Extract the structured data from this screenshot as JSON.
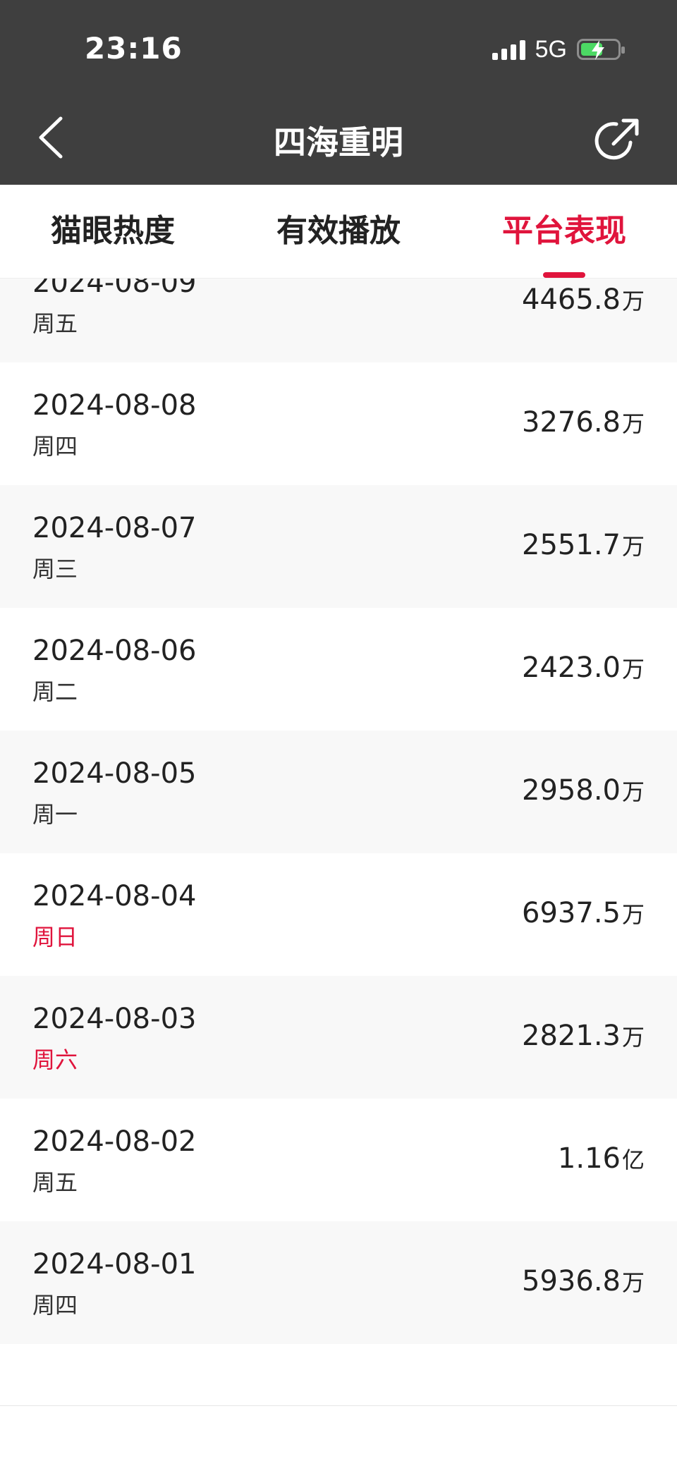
{
  "status_bar": {
    "time": "23:16",
    "network": "5G"
  },
  "nav": {
    "title": "四海重明",
    "back_icon": "chevron-left-icon",
    "share_icon": "share-refresh-icon"
  },
  "tabs": [
    {
      "label": "猫眼热度",
      "active": false
    },
    {
      "label": "有效播放",
      "active": false
    },
    {
      "label": "平台表现",
      "active": true
    }
  ],
  "colors": {
    "accent": "#e0143c",
    "header_bg": "#3f3f3f",
    "row_alt_bg": "#f8f8f8"
  },
  "rows": [
    {
      "date": "2024-08-09",
      "weekday": "周五",
      "value": "4465.8",
      "unit": "万",
      "weekend": false
    },
    {
      "date": "2024-08-08",
      "weekday": "周四",
      "value": "3276.8",
      "unit": "万",
      "weekend": false
    },
    {
      "date": "2024-08-07",
      "weekday": "周三",
      "value": "2551.7",
      "unit": "万",
      "weekend": false
    },
    {
      "date": "2024-08-06",
      "weekday": "周二",
      "value": "2423.0",
      "unit": "万",
      "weekend": false
    },
    {
      "date": "2024-08-05",
      "weekday": "周一",
      "value": "2958.0",
      "unit": "万",
      "weekend": false
    },
    {
      "date": "2024-08-04",
      "weekday": "周日",
      "value": "6937.5",
      "unit": "万",
      "weekend": true
    },
    {
      "date": "2024-08-03",
      "weekday": "周六",
      "value": "2821.3",
      "unit": "万",
      "weekend": true
    },
    {
      "date": "2024-08-02",
      "weekday": "周五",
      "value": "1.16",
      "unit": "亿",
      "weekend": false
    },
    {
      "date": "2024-08-01",
      "weekday": "周四",
      "value": "5936.8",
      "unit": "万",
      "weekend": false
    }
  ]
}
